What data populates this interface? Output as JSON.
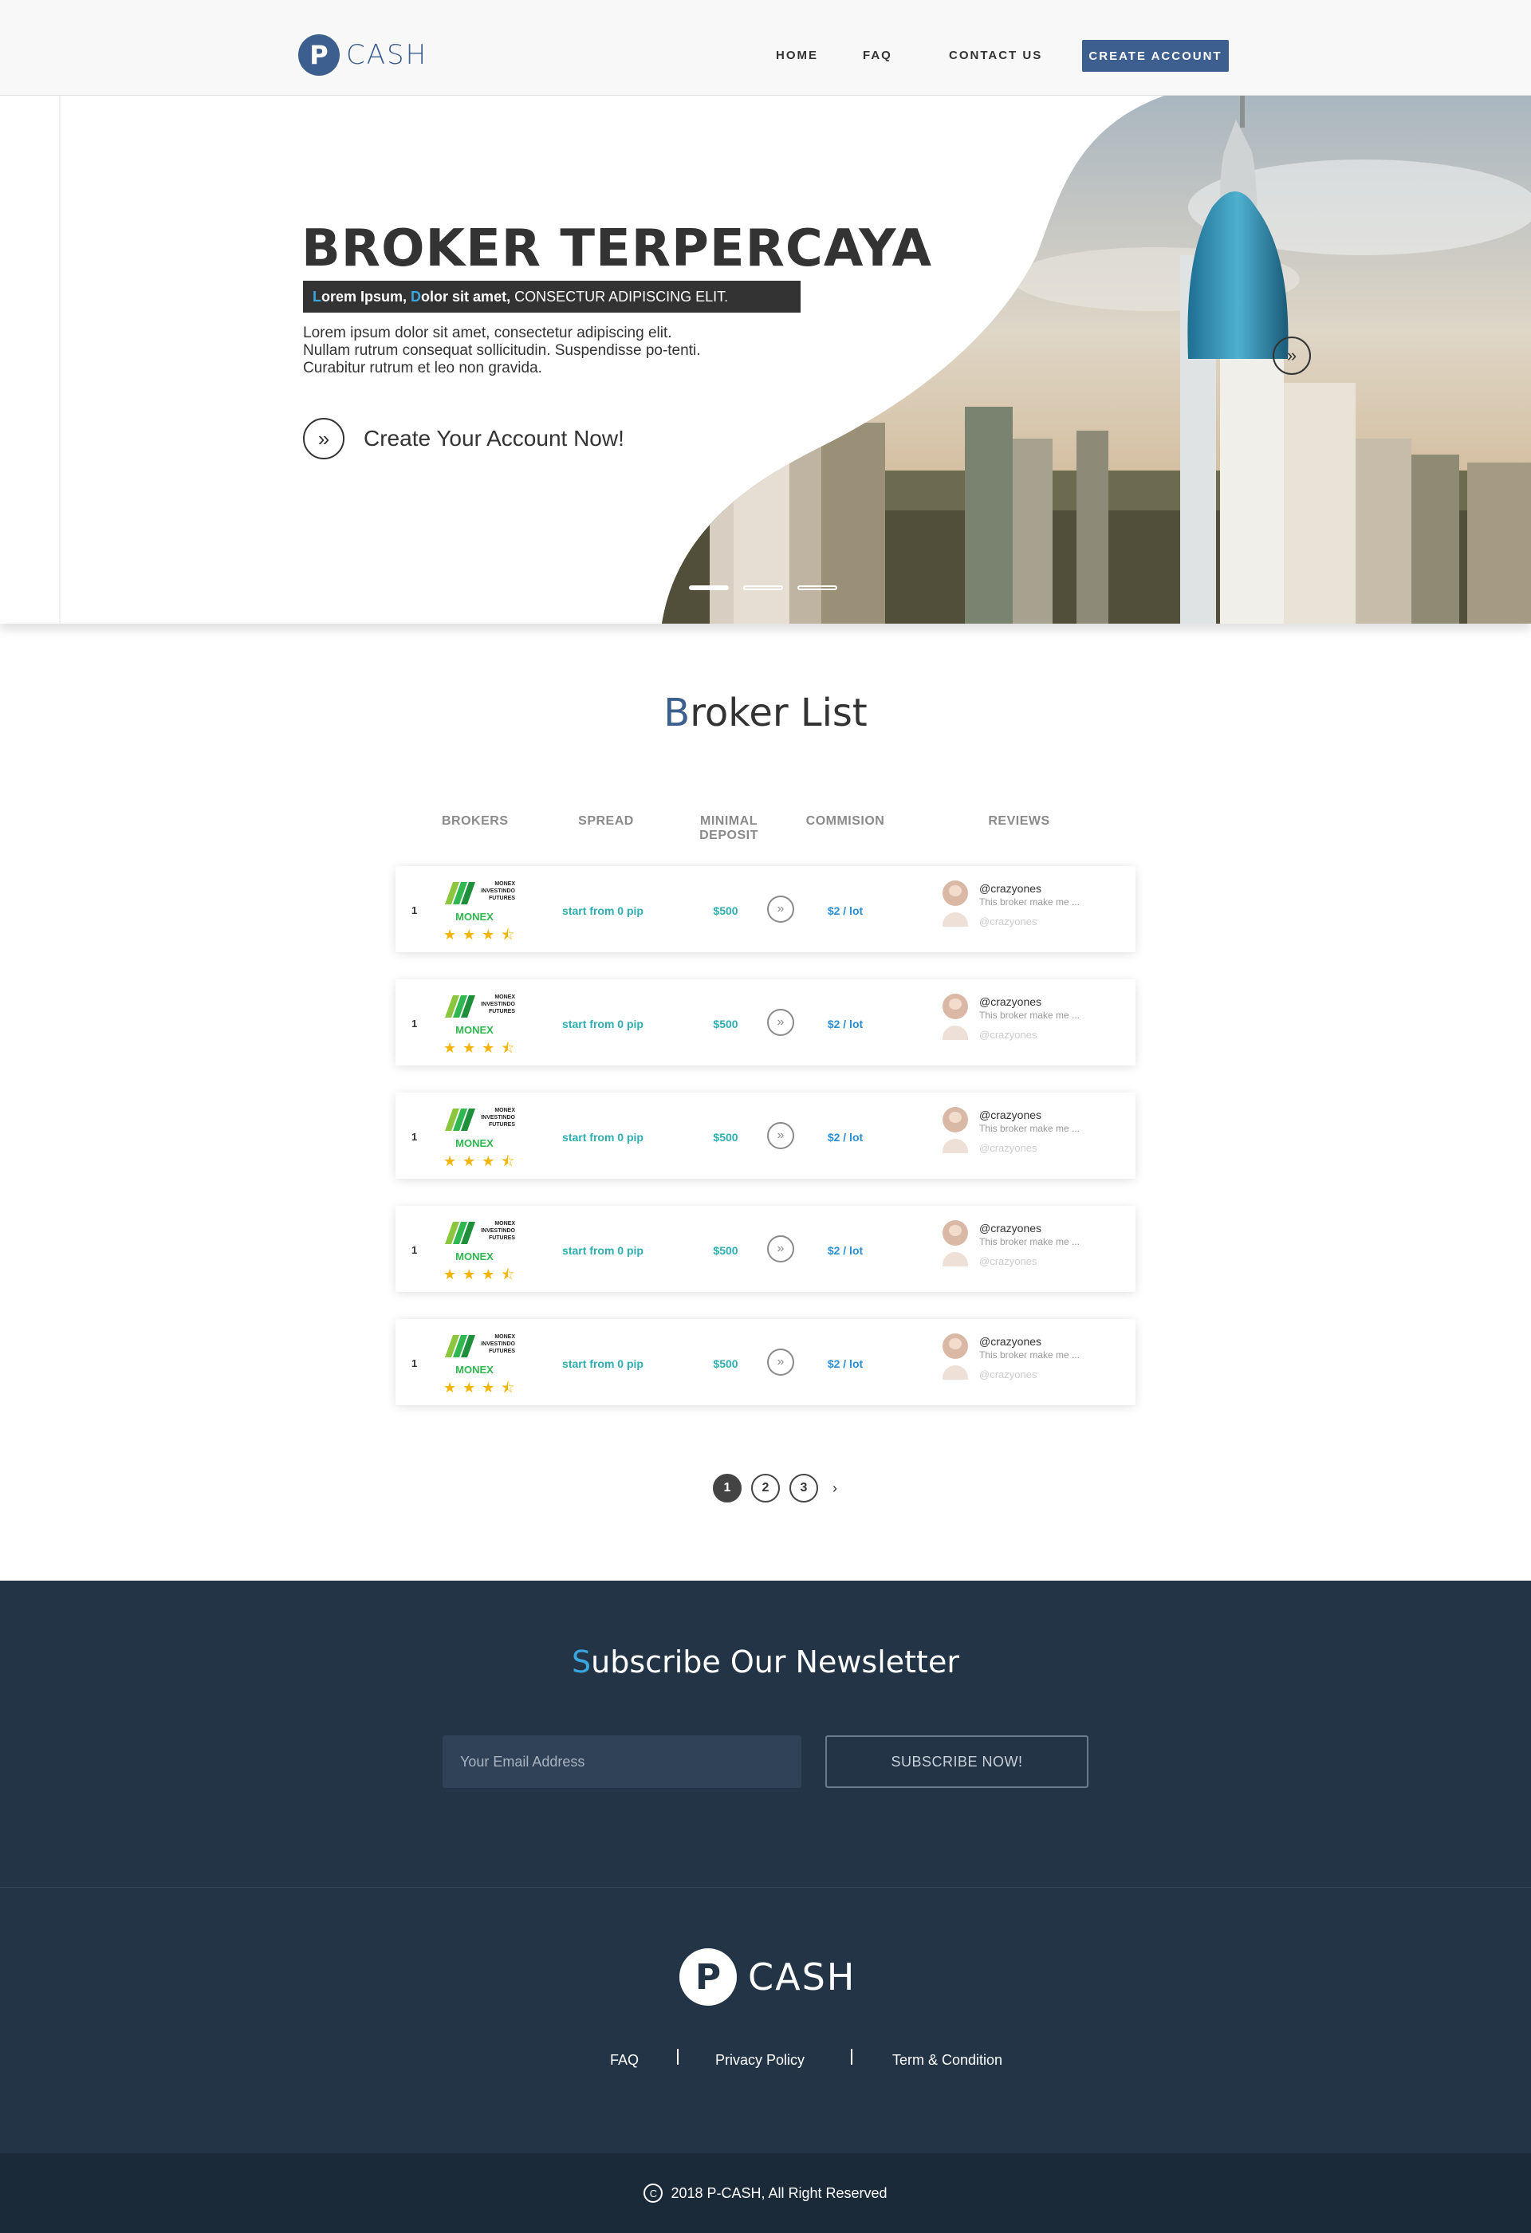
{
  "nav": {
    "logo_letter": "P",
    "logo_text": "CASH",
    "links": [
      "HOME",
      "FAQ",
      "CONTACT US"
    ],
    "cta": "CREATE ACCOUNT",
    "brand_color": "#3d5f8f"
  },
  "hero": {
    "title": "BROKER TERPERCAYA",
    "strip": {
      "p1_first": "L",
      "p1_rest": "orem Ipsum,",
      "p2_first": "D",
      "p2_rest": "olor sit amet,",
      "p3": "CONSECTUR ADIPISCING ELIT."
    },
    "description": "Lorem ipsum dolor sit amet, consectetur adipiscing elit. Nullam rutrum consequat sollicitudin. Suspendisse po-tenti. Curabitur rutrum et leo non gravida.",
    "cta_text": "Create Your Account Now!",
    "cta_icon": "double-chevron-right-icon",
    "slides": 3,
    "active_slide": 1
  },
  "broker_list": {
    "title_first": "B",
    "title_rest": "roker List",
    "columns": [
      "BROKERS",
      "SPREAD",
      "MINIMAL DEPOSIT",
      "COMMISION",
      "REVIEWS"
    ],
    "rows": [
      {
        "rank": "1",
        "logo_text": "MONEX INVESTINDO FUTURES",
        "name": "MONEX",
        "rating": 3.5,
        "spread": "start from 0 pip",
        "deposit": "$500",
        "commission": "$2 / lot",
        "review_user": "@crazyones",
        "review_text": "This broker make me ...",
        "review_user2": "@crazyones"
      },
      {
        "rank": "1",
        "logo_text": "MONEX INVESTINDO FUTURES",
        "name": "MONEX",
        "rating": 3.5,
        "spread": "start from 0 pip",
        "deposit": "$500",
        "commission": "$2 / lot",
        "review_user": "@crazyones",
        "review_text": "This broker make me ...",
        "review_user2": "@crazyones"
      },
      {
        "rank": "1",
        "logo_text": "MONEX INVESTINDO FUTURES",
        "name": "MONEX",
        "rating": 3.5,
        "spread": "start from 0 pip",
        "deposit": "$500",
        "commission": "$2 / lot",
        "review_user": "@crazyones",
        "review_text": "This broker make me ...",
        "review_user2": "@crazyones"
      },
      {
        "rank": "1",
        "logo_text": "MONEX INVESTINDO FUTURES",
        "name": "MONEX",
        "rating": 3.5,
        "spread": "start from 0 pip",
        "deposit": "$500",
        "commission": "$2 / lot",
        "review_user": "@crazyones",
        "review_text": "This broker make me ...",
        "review_user2": "@crazyones"
      },
      {
        "rank": "1",
        "logo_text": "MONEX INVESTINDO FUTURES",
        "name": "MONEX",
        "rating": 3.5,
        "spread": "start from 0 pip",
        "deposit": "$500",
        "commission": "$2 / lot",
        "review_user": "@crazyones",
        "review_text": "This broker make me ...",
        "review_user2": "@crazyones"
      }
    ],
    "pagination": {
      "pages": [
        "1",
        "2",
        "3"
      ],
      "active": "1",
      "next": "›"
    }
  },
  "newsletter": {
    "title_first": "S",
    "title_rest": "ubscribe Our Newsletter",
    "placeholder": "Your Email Address",
    "button": "SUBSCRIBE NOW!"
  },
  "footer": {
    "logo_letter": "P",
    "logo_text": "CASH",
    "links": [
      "FAQ",
      "Privacy Policy",
      "Term & Condition"
    ],
    "copyright": "2018 P-CASH, All  Right Reserved",
    "copyright_symbol": "C"
  }
}
